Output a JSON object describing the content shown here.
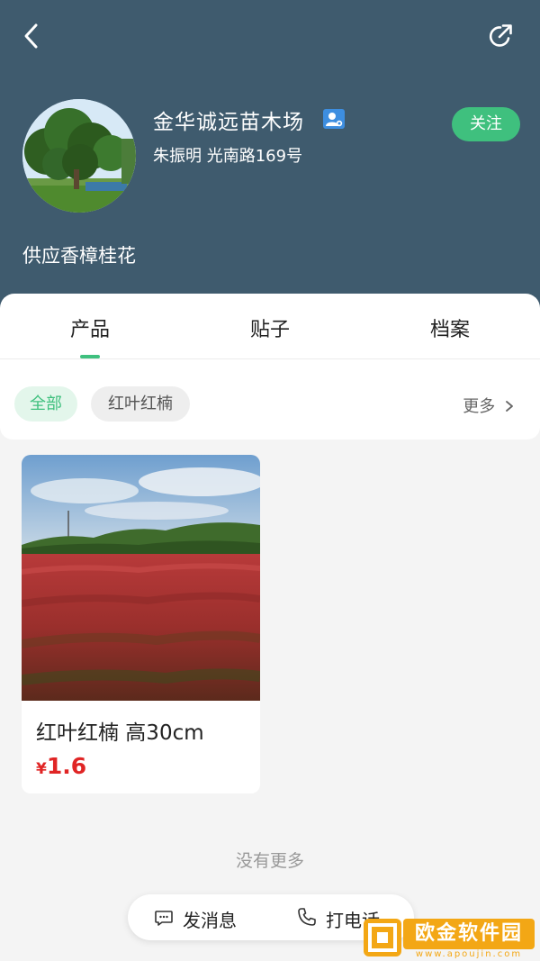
{
  "header": {
    "shop_name": "金华诚远苗木场",
    "owner_address": "朱振明 光南路169号",
    "follow_label": "关注",
    "description": "供应香樟桂花"
  },
  "tabs": [
    {
      "label": "产品",
      "active": true
    },
    {
      "label": "贴子",
      "active": false
    },
    {
      "label": "档案",
      "active": false
    }
  ],
  "filters": {
    "chips": [
      "全部",
      "红叶红楠"
    ],
    "selected": "全部",
    "more_label": "更多"
  },
  "products": [
    {
      "title": "红叶红楠 高30cm",
      "currency": "¥",
      "price": "1.6"
    }
  ],
  "list_end_text": "没有更多",
  "actions": {
    "message_label": "发消息",
    "call_label": "打电话"
  },
  "watermark": {
    "text": "欧金软件园",
    "url": "www.apoujin.com"
  },
  "colors": {
    "header_bg": "#3f5b6e",
    "accent_green": "#3fc07e",
    "price_red": "#e02525",
    "watermark_orange": "#f3a715"
  }
}
